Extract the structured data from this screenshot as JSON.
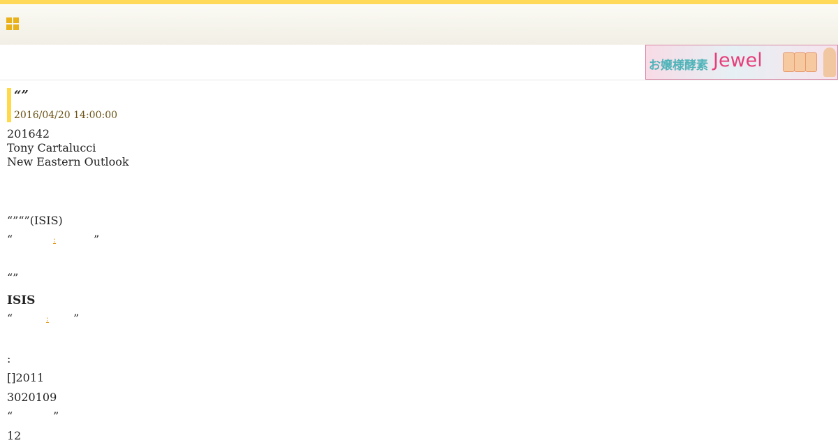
{
  "colors": {
    "accent_yellow": "#ffd95a",
    "link_orange": "#e39a1b",
    "date_brown": "#6b5316",
    "header_bg": "#f1efe5",
    "ad_pink": "#e63e7a",
    "ad_teal": "#4fb4b9"
  },
  "header": {
    "menu_icon": "grid-menu-icon"
  },
  "ad": {
    "jp_text": "お嬢様酵素",
    "brand": "Jewel"
  },
  "article": {
    "title": "“”",
    "date": "2016/04/20 14:00:00",
    "meta_date": "201642",
    "author": "Tony Cartalucci",
    "source": "New Eastern Outlook",
    "lines": [
      "“”“”(ISIS)",
      "“",
      "”",
      "“”",
      "ISIS",
      "“",
      "”",
      ":",
      "[]2011",
      "3020109",
      "“",
      "”",
      "12"
    ],
    "links": [
      ":",
      ":",
      ""
    ]
  }
}
